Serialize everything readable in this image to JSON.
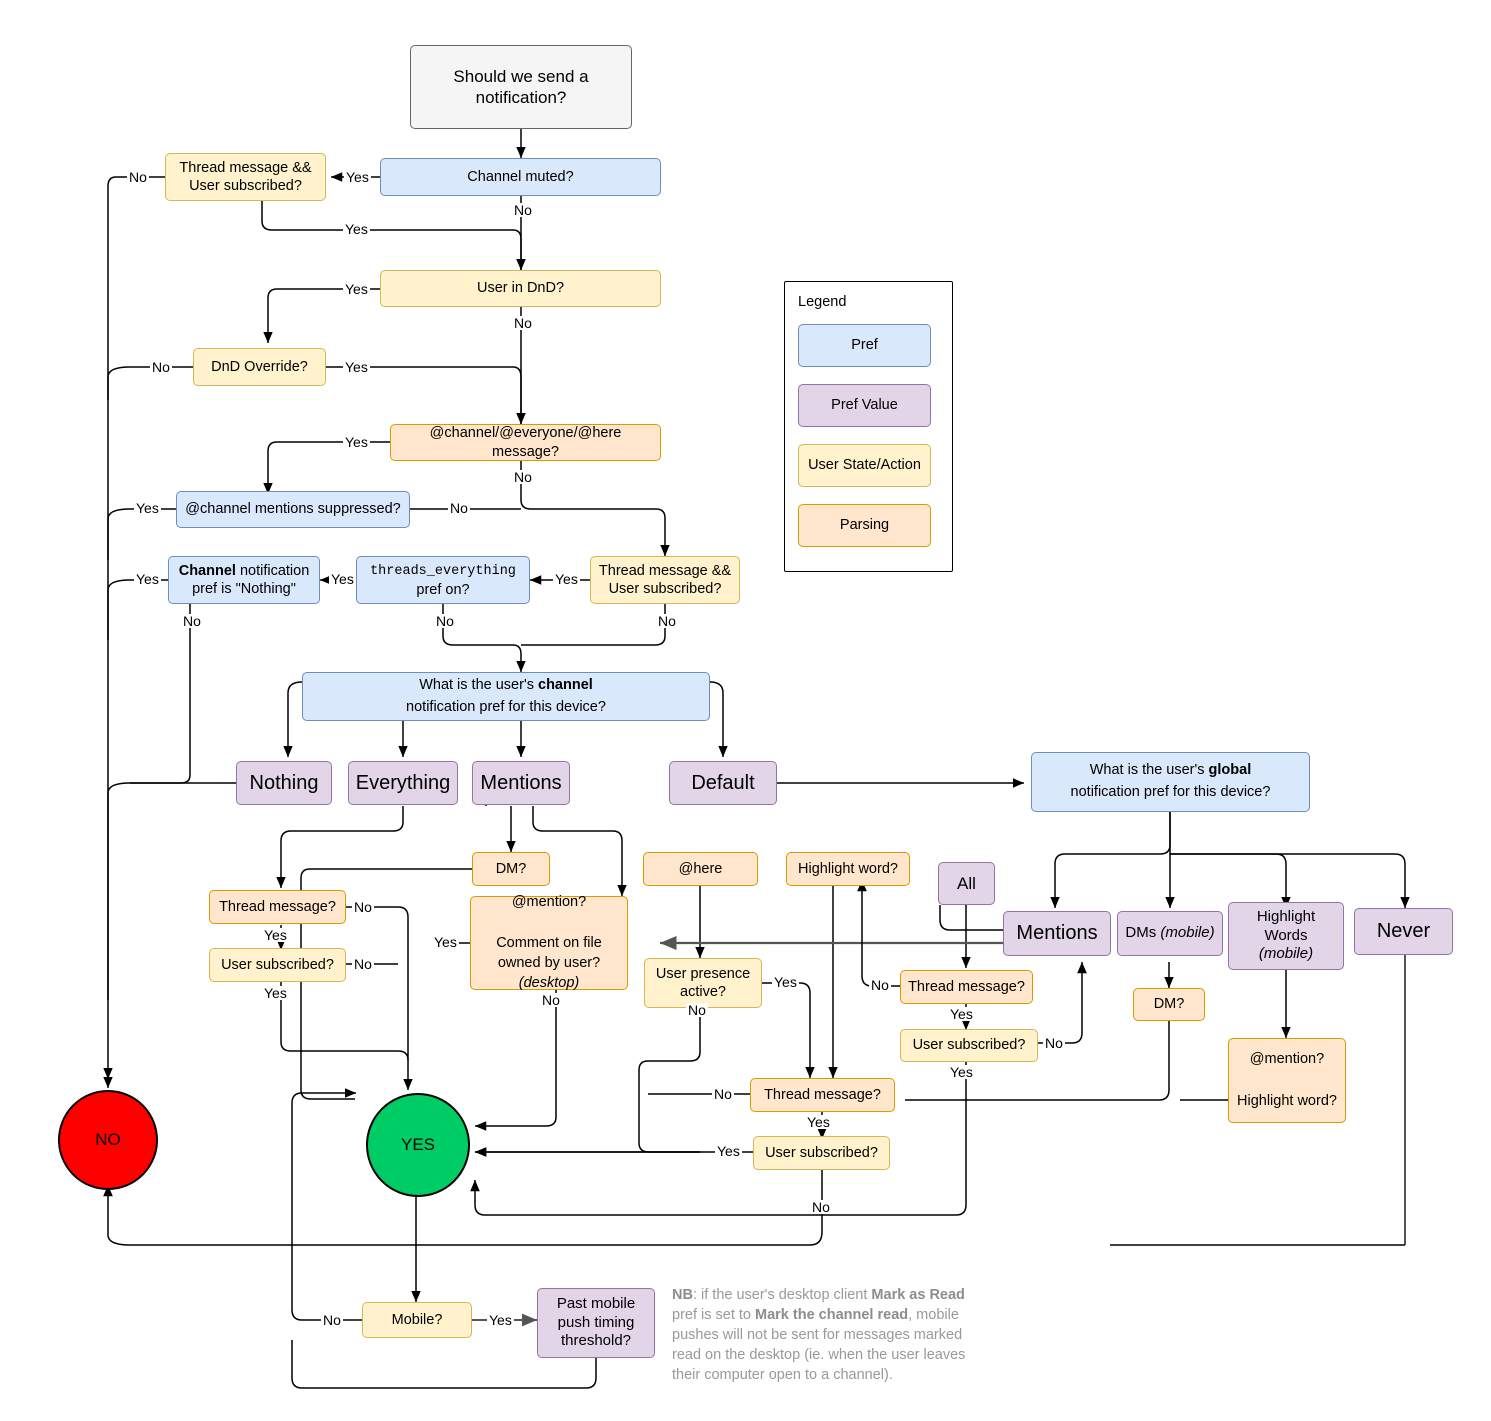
{
  "title": "Slack notification decision flowchart",
  "legend": {
    "title": "Legend",
    "items": [
      {
        "label": "Pref",
        "kind": "pref",
        "color": "#dae8fc",
        "border": "#6c8ebf"
      },
      {
        "label": "Pref Value",
        "kind": "prefval",
        "color": "#e1d5e7",
        "border": "#9673a6"
      },
      {
        "label": "User State/Action",
        "kind": "userstate",
        "color": "#fff2cc",
        "border": "#d6b656"
      },
      {
        "label": "Parsing",
        "kind": "parsing",
        "color": "#ffe6cc",
        "border": "#d79b00"
      }
    ]
  },
  "nodes": {
    "start": "Should we send a notification?",
    "channel_muted": "Channel muted?",
    "thread_sub_1_line1": "Thread message &&",
    "thread_sub_1_line2": "User subscribed?",
    "user_dnd": "User in DnD?",
    "dnd_override": "DnD Override?",
    "at_channel_msg": "@channel/@everyone/@here message?",
    "mentions_suppressed": "@channel mentions suppressed?",
    "channel_pref_nothing_strong": "Channel",
    "channel_pref_nothing_rest": " notification pref is \"Nothing\"",
    "threads_everything_mono": "threads_everything",
    "threads_everything_rest": "pref on?",
    "thread_sub_2_line1": "Thread message &&",
    "thread_sub_2_line2": "User subscribed?",
    "channel_pref_q_line1_a": "What is the user's ",
    "channel_pref_q_line1_b": "channel",
    "channel_pref_q_line2": "notification pref for this device?",
    "pv_nothing": "Nothing",
    "pv_everything": "Everything",
    "pv_mentions": "Mentions",
    "pv_default": "Default",
    "global_pref_q_line1_a": "What is the user's ",
    "global_pref_q_line1_b": "global",
    "global_pref_q_line2": "notification pref for this device?",
    "dm_q": "DM?",
    "at_here": "@here",
    "highlight_word_q": "Highlight word?",
    "pv_all": "All",
    "pv_g_mentions": "Mentions",
    "pv_dms_mobile_a": "DMs ",
    "pv_dms_mobile_b": "(mobile)",
    "pv_highlight_words_a": "Highlight Words",
    "pv_highlight_words_b": "(mobile)",
    "pv_never": "Never",
    "thread_message_left": "Thread message?",
    "user_subscribed_left": "User subscribed?",
    "mention_file_line1": "@mention?",
    "mention_file_line2_a": "Comment on file owned by user? ",
    "mention_file_line2_b": "(desktop)",
    "user_presence_active_line1": "User presence",
    "user_presence_active_line2": "active?",
    "thread_message_right": "Thread message?",
    "user_subscribed_right": "User subscribed?",
    "dm_q2": "DM?",
    "mention_highlight_line1": "@mention?",
    "mention_highlight_line2": "Highlight word?",
    "thread_message_bottom": "Thread message?",
    "user_subscribed_bottom": "User subscribed?",
    "no_terminal": "NO",
    "yes_terminal": "YES",
    "mobile_q": "Mobile?",
    "past_push_line1": "Past mobile",
    "past_push_line2": "push timing",
    "past_push_line3": "threshold?"
  },
  "edge_labels": {
    "yes": "Yes",
    "no": "No"
  },
  "note": {
    "prefix": "NB",
    "part1": ": if the user's desktop client ",
    "bold1": "Mark as Read",
    "part2": " pref is set to ",
    "bold2": "Mark the channel read",
    "part3": ", mobile pushes will not be sent for messages marked read on the desktop (ie. when the user leaves their computer open to a channel)."
  },
  "colors": {
    "pref_fill": "#dae8fc",
    "pref_stroke": "#6c8ebf",
    "prefval_fill": "#e1d5e7",
    "prefval_stroke": "#9673a6",
    "userstate_fill": "#fff2cc",
    "userstate_stroke": "#d6b656",
    "parsing_fill": "#ffe6cc",
    "parsing_stroke": "#d79b00",
    "start_fill": "#f5f5f5",
    "start_stroke": "#666666",
    "no_fill": "#ff0000",
    "yes_fill": "#00cc66",
    "edge": "#000000",
    "note_text": "#999999"
  }
}
